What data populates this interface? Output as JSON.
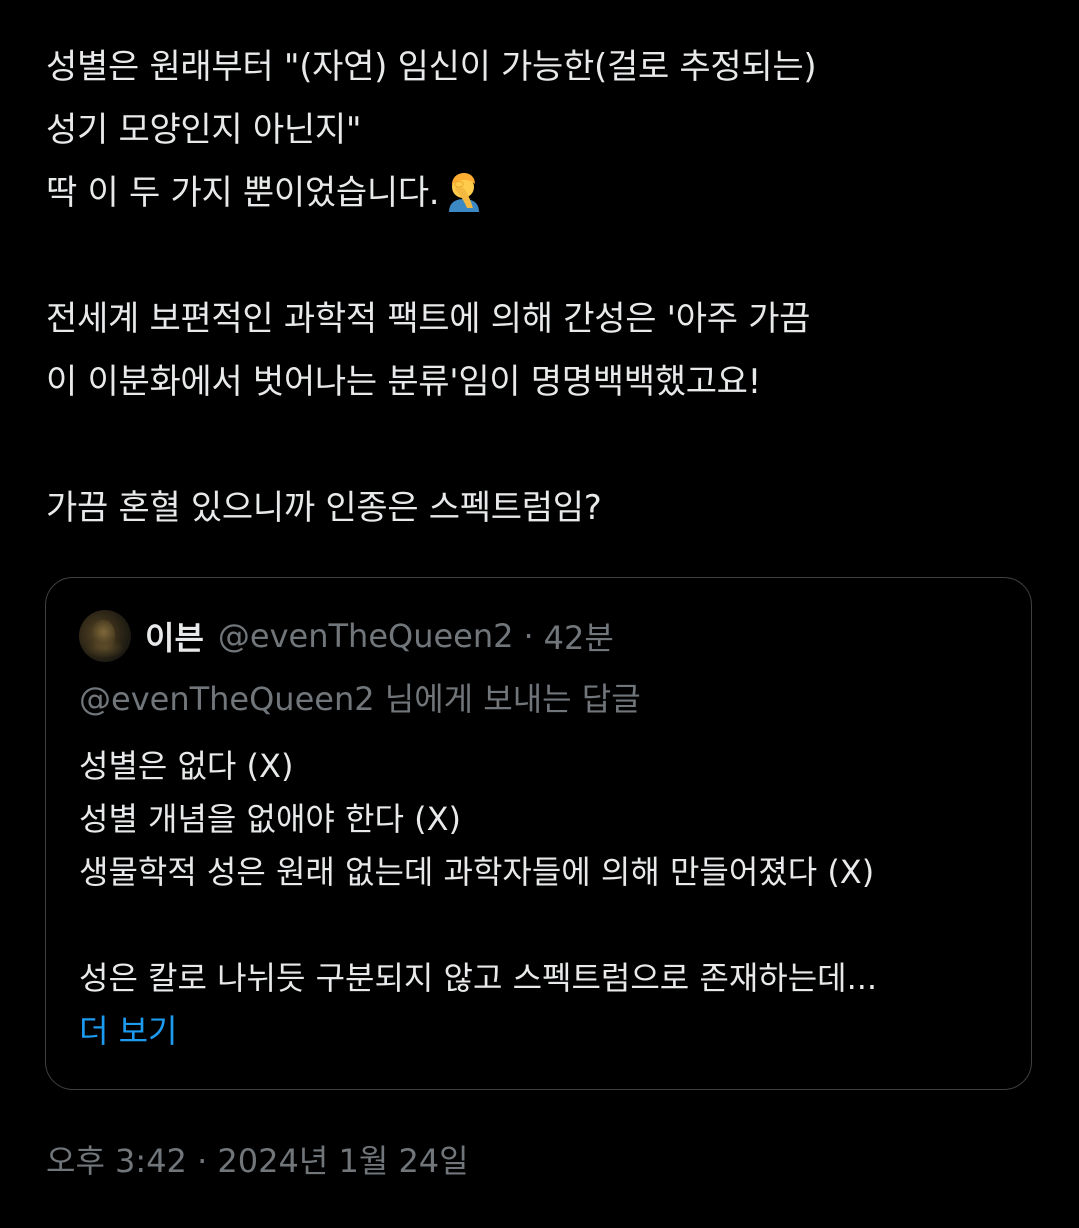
{
  "tweet": {
    "lines": [
      "성별은 원래부터 \"(자연) 임신이 가능한(걸로 추정되는)",
      "성기 모양인지 아닌지\"",
      "딱 이 두 가지 뿐이었습니다.",
      "전세계 보편적인 과학적 팩트에 의해 간성은 '아주 가끔",
      "이 이분화에서 벗어나는 분류'임이 명명백백했고요!",
      "가끔 혼혈 있으니까 인종은 스펙트럼임?"
    ],
    "emoji": "facepalm-icon",
    "timestamp": "오후 3:42 · 2024년 1월 24일"
  },
  "quote": {
    "name": "이븐",
    "handle": "@evenTheQueen2",
    "separator": "·",
    "time": "42분",
    "reply_to": "@evenTheQueen2 님에게 보내는 답글",
    "lines": [
      "성별은 없다 (X)",
      "성별 개념을 없애야 한다 (X)",
      "생물학적 성은 원래 없는데 과학자들에 의해 만들어졌다 (X)",
      "성은 칼로 나뉘듯 구분되지 않고 스펙트럼으로 존재하는데..."
    ],
    "show_more": "더 보기"
  },
  "colors": {
    "background": "#000000",
    "text": "#e7e9ea",
    "muted": "#71767b",
    "link": "#1d9bf0",
    "border": "#3e4144"
  }
}
